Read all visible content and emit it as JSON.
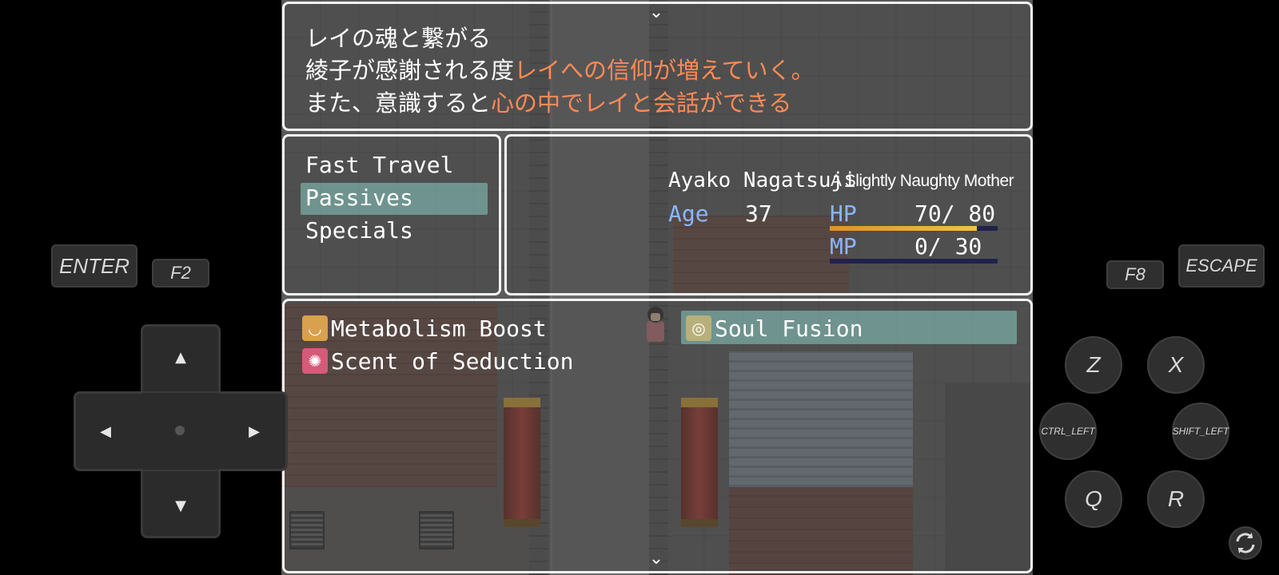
{
  "help": {
    "line1": "レイの魂と繋がる",
    "line2_prefix": "綾子が感謝される度",
    "line2_highlight": "レイへの信仰が増えていく。",
    "line3_prefix": "また、意識すると",
    "line3_highlight": "心の中でレイと会話ができる"
  },
  "menu": {
    "items": [
      "Fast Travel",
      "Passives",
      "Specials"
    ],
    "selected": "Passives"
  },
  "status": {
    "name": "Ayako Nagatsuji",
    "title": "A Slightly Naughty Mother",
    "age_label": "Age",
    "age": "37",
    "hp_label": "HP",
    "hp_text": "70/  80",
    "hp_fraction": 0.875,
    "mp_label": "MP",
    "mp_text": "0/  30",
    "mp_fraction": 0.0
  },
  "skills": [
    {
      "name": "Metabolism Boost",
      "icon": "metabolism-icon"
    },
    {
      "name": "Scent of Seduction",
      "icon": "seduction-icon"
    },
    {
      "name": "Soul Fusion",
      "icon": "soul-icon"
    }
  ],
  "selected_skill": "Soul Fusion",
  "controls": {
    "enter": "ENTER",
    "f2": "F2",
    "f8": "F8",
    "escape": "ESCAPE",
    "z": "Z",
    "x": "X",
    "ctrl_left": "CTRL_LEFT",
    "shift_left": "SHIFT_LEFT",
    "q": "Q",
    "r": "R"
  },
  "colors": {
    "highlight_text": "#ff8a55",
    "stat_label": "#8ab6ff",
    "selection": "#96e6dc"
  }
}
